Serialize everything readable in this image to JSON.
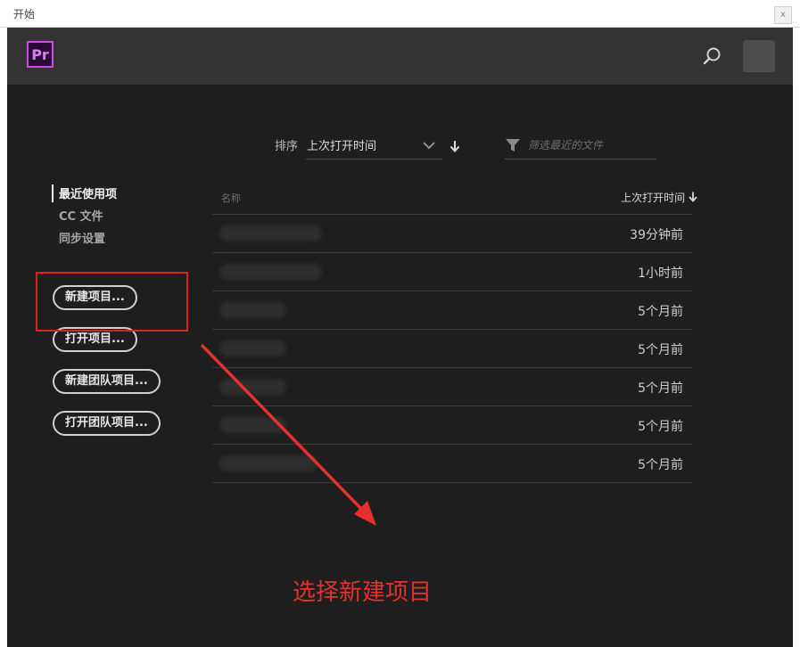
{
  "window": {
    "title": "开始",
    "close_label": "x"
  },
  "app": {
    "logo_text": "Pr"
  },
  "sort": {
    "label": "排序",
    "selected": "上次打开时间"
  },
  "filter": {
    "placeholder": "筛选最近的文件"
  },
  "nav": [
    {
      "label": "最近使用项"
    },
    {
      "label": "CC 文件"
    },
    {
      "label": "同步设置"
    }
  ],
  "actions": {
    "new_project": "新建项目...",
    "open_project": "打开项目...",
    "new_team_project": "新建团队项目...",
    "open_team_project": "打开团队项目..."
  },
  "table": {
    "col_name": "名称",
    "col_time": "上次打开时间",
    "rows": [
      {
        "time": "39分钟前"
      },
      {
        "time": "1小时前"
      },
      {
        "time": "5个月前"
      },
      {
        "time": "5个月前"
      },
      {
        "time": "5个月前"
      },
      {
        "time": "5个月前"
      },
      {
        "time": "5个月前"
      }
    ]
  },
  "annotation": {
    "text": "选择新建项目",
    "color": "#e53030"
  },
  "colors": {
    "accent_pr": "#c44fe0",
    "background": "#1e1e1e",
    "header": "#333333"
  }
}
